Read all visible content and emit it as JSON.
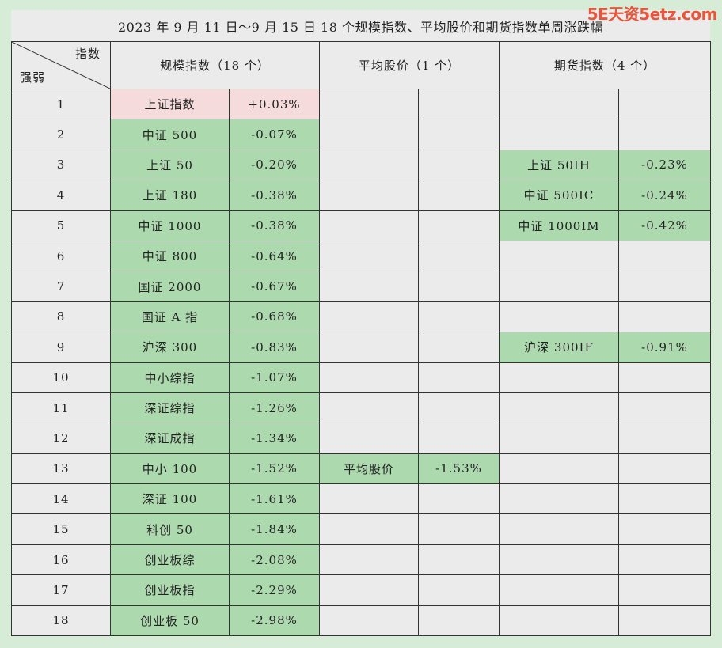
{
  "title": "2023 年 9 月 11 日～9 月 15 日 18 个规模指数、平均股价和期货指数单周涨跌幅",
  "watermark": "5E天资5etz.com",
  "header": {
    "corner_top": "指数",
    "corner_bottom": "强弱",
    "col_scale": "规模指数（18 个）",
    "col_avg": "平均股价（1 个）",
    "col_futures": "期货指数（4 个）"
  },
  "colors": {
    "green": "#acd9ae",
    "pink": "#f5dbdb",
    "background": "#d6ecd7"
  },
  "rows": [
    {
      "rank": "1",
      "scale_name": "上证指数",
      "scale_value": "+0.03%",
      "scale_color": "pink",
      "avg_name": "",
      "avg_value": "",
      "fut_name": "",
      "fut_value": ""
    },
    {
      "rank": "2",
      "scale_name": "中证 500",
      "scale_value": "-0.07%",
      "scale_color": "green",
      "avg_name": "",
      "avg_value": "",
      "fut_name": "",
      "fut_value": ""
    },
    {
      "rank": "3",
      "scale_name": "上证 50",
      "scale_value": "-0.20%",
      "scale_color": "green",
      "avg_name": "",
      "avg_value": "",
      "fut_name": "上证 50IH",
      "fut_value": "-0.23%"
    },
    {
      "rank": "4",
      "scale_name": "上证 180",
      "scale_value": "-0.38%",
      "scale_color": "green",
      "avg_name": "",
      "avg_value": "",
      "fut_name": "中证 500IC",
      "fut_value": "-0.24%"
    },
    {
      "rank": "5",
      "scale_name": "中证 1000",
      "scale_value": "-0.38%",
      "scale_color": "green",
      "avg_name": "",
      "avg_value": "",
      "fut_name": "中证 1000IM",
      "fut_value": "-0.42%"
    },
    {
      "rank": "6",
      "scale_name": "中证 800",
      "scale_value": "-0.64%",
      "scale_color": "green",
      "avg_name": "",
      "avg_value": "",
      "fut_name": "",
      "fut_value": ""
    },
    {
      "rank": "7",
      "scale_name": "国证 2000",
      "scale_value": "-0.67%",
      "scale_color": "green",
      "avg_name": "",
      "avg_value": "",
      "fut_name": "",
      "fut_value": ""
    },
    {
      "rank": "8",
      "scale_name": "国证 A 指",
      "scale_value": "-0.68%",
      "scale_color": "green",
      "avg_name": "",
      "avg_value": "",
      "fut_name": "",
      "fut_value": ""
    },
    {
      "rank": "9",
      "scale_name": "沪深 300",
      "scale_value": "-0.83%",
      "scale_color": "green",
      "avg_name": "",
      "avg_value": "",
      "fut_name": "沪深 300IF",
      "fut_value": "-0.91%"
    },
    {
      "rank": "10",
      "scale_name": "中小综指",
      "scale_value": "-1.07%",
      "scale_color": "green",
      "avg_name": "",
      "avg_value": "",
      "fut_name": "",
      "fut_value": ""
    },
    {
      "rank": "11",
      "scale_name": "深证综指",
      "scale_value": "-1.26%",
      "scale_color": "green",
      "avg_name": "",
      "avg_value": "",
      "fut_name": "",
      "fut_value": ""
    },
    {
      "rank": "12",
      "scale_name": "深证成指",
      "scale_value": "-1.34%",
      "scale_color": "green",
      "avg_name": "",
      "avg_value": "",
      "fut_name": "",
      "fut_value": ""
    },
    {
      "rank": "13",
      "scale_name": "中小 100",
      "scale_value": "-1.52%",
      "scale_color": "green",
      "avg_name": "平均股价",
      "avg_value": "-1.53%",
      "fut_name": "",
      "fut_value": ""
    },
    {
      "rank": "14",
      "scale_name": "深证 100",
      "scale_value": "-1.61%",
      "scale_color": "green",
      "avg_name": "",
      "avg_value": "",
      "fut_name": "",
      "fut_value": ""
    },
    {
      "rank": "15",
      "scale_name": "科创 50",
      "scale_value": "-1.84%",
      "scale_color": "green",
      "avg_name": "",
      "avg_value": "",
      "fut_name": "",
      "fut_value": ""
    },
    {
      "rank": "16",
      "scale_name": "创业板综",
      "scale_value": "-2.08%",
      "scale_color": "green",
      "avg_name": "",
      "avg_value": "",
      "fut_name": "",
      "fut_value": ""
    },
    {
      "rank": "17",
      "scale_name": "创业板指",
      "scale_value": "-2.29%",
      "scale_color": "green",
      "avg_name": "",
      "avg_value": "",
      "fut_name": "",
      "fut_value": ""
    },
    {
      "rank": "18",
      "scale_name": "创业板 50",
      "scale_value": "-2.98%",
      "scale_color": "green",
      "avg_name": "",
      "avg_value": "",
      "fut_name": "",
      "fut_value": ""
    }
  ]
}
